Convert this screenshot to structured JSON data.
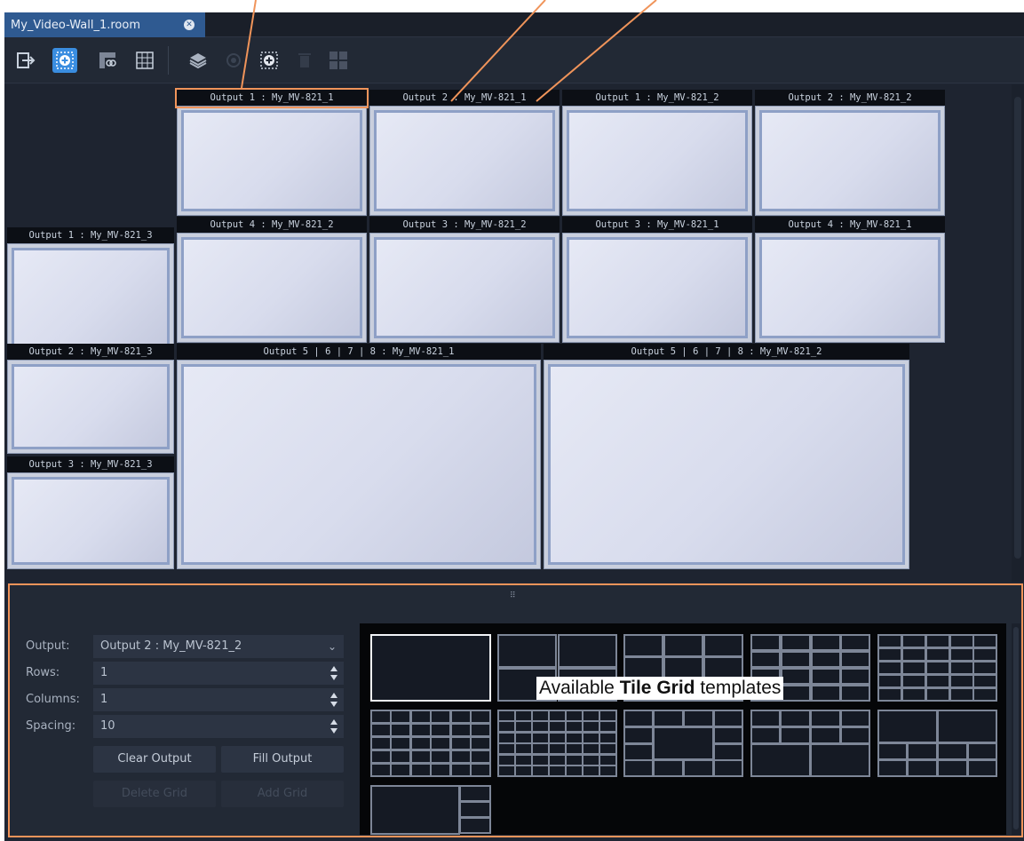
{
  "tab": {
    "title": "My_Video-Wall_1.room",
    "close_icon": "close-icon"
  },
  "toolbar": {
    "icons": [
      "exit-icon",
      "add-tile-icon",
      "link-icon",
      "grid-icon",
      "layers-icon",
      "loop-icon",
      "add-grid-icon",
      "delete-icon",
      "tiles-icon"
    ],
    "active": "add-tile-icon"
  },
  "tiles": [
    {
      "label": "Output 1 : My_MV-821_1",
      "highlighted": true
    },
    {
      "label": "Output 2 : My_MV-821_1"
    },
    {
      "label": "Output 1 : My_MV-821_2"
    },
    {
      "label": "Output 2 : My_MV-821_2"
    },
    {
      "label": "Output 1 : My_MV-821_3"
    },
    {
      "label": "Output 4 : My_MV-821_2"
    },
    {
      "label": "Output 3 : My_MV-821_2"
    },
    {
      "label": "Output 3 : My_MV-821_1"
    },
    {
      "label": "Output 4 : My_MV-821_1"
    },
    {
      "label": "Output 2 : My_MV-821_3"
    },
    {
      "label": "Output 5 | 6 | 7 | 8 : My_MV-821_1"
    },
    {
      "label": "Output 5 | 6 | 7 | 8 : My_MV-821_2"
    },
    {
      "label": "Output 3 : My_MV-821_3"
    }
  ],
  "panel": {
    "output_label": "Output:",
    "output_value": "Output 2 : My_MV-821_2",
    "rows_label": "Rows:",
    "rows_value": "1",
    "columns_label": "Columns:",
    "columns_value": "1",
    "spacing_label": "Spacing:",
    "spacing_value": "10",
    "clear_output": "Clear Output",
    "fill_output": "Fill Output",
    "delete_grid": "Delete Grid",
    "add_grid": "Add Grid"
  },
  "annotation": {
    "prefix": "Available ",
    "bold": "Tile Grid",
    "suffix": " templates"
  },
  "colors": {
    "accent": "#3a8de0",
    "callout": "#f0945a",
    "tab": "#2f5a91"
  }
}
